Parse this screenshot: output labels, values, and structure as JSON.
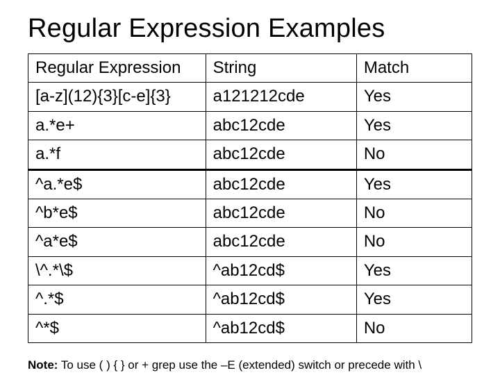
{
  "title": "Regular Expression Examples",
  "headers": {
    "regex": "Regular Expression",
    "string": "String",
    "match": "Match"
  },
  "rows": [
    {
      "regex": "[a-z](12){3}[c-e]{3}",
      "string": "a121212cde",
      "match": "Yes"
    },
    {
      "regex": "a.*e+",
      "string": "abc12cde",
      "match": "Yes"
    },
    {
      "regex": "a.*f",
      "string": "abc12cde",
      "match": "No"
    },
    {
      "regex": "^a.*e$",
      "string": "abc12cde",
      "match": "Yes"
    },
    {
      "regex": "^b*e$",
      "string": "abc12cde",
      "match": "No"
    },
    {
      "regex": "^a*e$",
      "string": "abc12cde",
      "match": "No"
    },
    {
      "regex": "\\^.*\\$",
      "string": "^ab12cd$",
      "match": "Yes"
    },
    {
      "regex": "^.*$",
      "string": "^ab12cd$",
      "match": "Yes"
    },
    {
      "regex": "^*$",
      "string": "^ab12cd$",
      "match": "No"
    }
  ],
  "note": {
    "label": "Note:",
    "text": " To use ( ) { } or + grep use the –E (extended) switch or precede with \\"
  }
}
